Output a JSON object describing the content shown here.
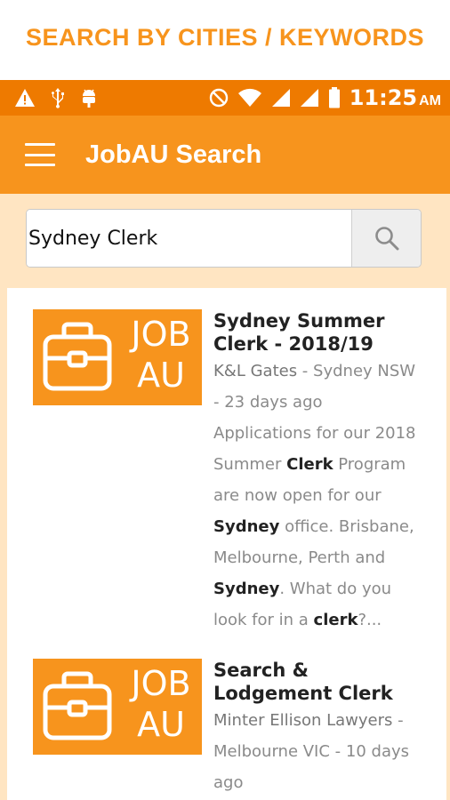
{
  "banner": {
    "text": "SEARCH BY CITIES / KEYWORDS"
  },
  "status_bar": {
    "icons_left": [
      "warning-icon",
      "usb-icon",
      "android-debug-icon"
    ],
    "icons_right": [
      "do-not-disturb-icon",
      "wifi-icon",
      "signal-icon",
      "signal-icon-2",
      "battery-icon"
    ],
    "time": "11:25",
    "ampm": "AM"
  },
  "app_bar": {
    "title": "JobAU Search"
  },
  "search": {
    "value": "Sydney Clerk",
    "button_icon": "search-icon"
  },
  "logo": {
    "line1": "JOB",
    "line2": "AU"
  },
  "jobs": [
    {
      "title": "Sydney Summer Clerk - 2018/19",
      "company": "K&L Gates",
      "location": "Sydney NSW",
      "age": "23 days ago",
      "description": [
        {
          "t": "Applications for our 2018 Summer ",
          "b": false
        },
        {
          "t": "Clerk",
          "b": true
        },
        {
          "t": " Program are now open for our ",
          "b": false
        },
        {
          "t": "Sydney",
          "b": true
        },
        {
          "t": " office. Brisbane, Melbourne, Perth and ",
          "b": false
        },
        {
          "t": "Sydney",
          "b": true
        },
        {
          "t": ". What do you look for in a ",
          "b": false
        },
        {
          "t": "clerk",
          "b": true
        },
        {
          "t": "?...",
          "b": false
        }
      ]
    },
    {
      "title": "Search & Lodgement Clerk",
      "company": "Minter Ellison Lawyers",
      "location": "Melbourne VIC",
      "age": "10 days ago",
      "description": []
    }
  ],
  "colors": {
    "accent": "#F7941D",
    "status_bar": "#EE7A00",
    "background": "#FFE5C2"
  }
}
